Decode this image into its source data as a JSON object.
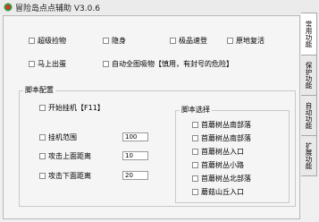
{
  "window": {
    "title": "冒险岛点点辅助 V3.0.6"
  },
  "options": [
    {
      "label": "超级捡物",
      "checked": false
    },
    {
      "label": "隐身",
      "checked": false
    },
    {
      "label": "极品速登",
      "checked": false
    },
    {
      "label": "原地复活",
      "checked": false
    },
    {
      "label": "马上出蛋",
      "checked": false
    },
    {
      "label": "自动全图吸物【慎用，有封号的危险】",
      "checked": false
    }
  ],
  "script_config": {
    "title": "脚本配置",
    "start_hotkey": {
      "label": "开始挂机【F11】",
      "checked": false
    },
    "fields": [
      {
        "label": "挂机范围",
        "value": "100"
      },
      {
        "label": "攻击上面距离",
        "value": "10"
      },
      {
        "label": "攻击下面距离",
        "value": "20"
      }
    ]
  },
  "script_select": {
    "title": "脚本选择",
    "items": [
      {
        "label": "首蘑树丛南部落",
        "checked": false
      },
      {
        "label": "首蘑树丛南部落",
        "checked": false
      },
      {
        "label": "首蘑树丛入口",
        "checked": false
      },
      {
        "label": "首蘑树丛小路",
        "checked": false
      },
      {
        "label": "首蘑树丛北部落",
        "checked": false
      },
      {
        "label": "蘑菇山丘入口",
        "checked": false
      }
    ]
  },
  "tabs": [
    {
      "label": "常用功能",
      "active": true
    },
    {
      "label": "保护功能",
      "active": false
    },
    {
      "label": "自动功能",
      "active": false
    },
    {
      "label": "扩展功能",
      "active": false
    }
  ],
  "colors": {
    "icon_red": "#d9342b",
    "icon_green": "#2f9a3a"
  }
}
